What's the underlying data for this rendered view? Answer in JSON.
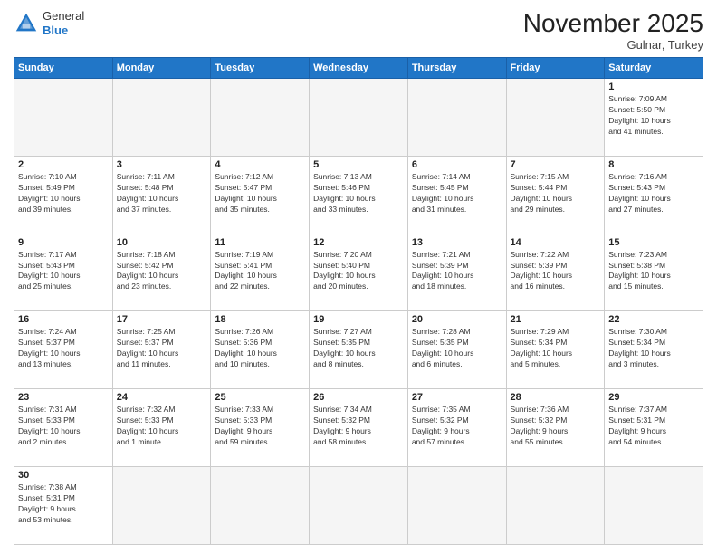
{
  "header": {
    "logo_general": "General",
    "logo_blue": "Blue",
    "month_year": "November 2025",
    "location": "Gulnar, Turkey"
  },
  "weekdays": [
    "Sunday",
    "Monday",
    "Tuesday",
    "Wednesday",
    "Thursday",
    "Friday",
    "Saturday"
  ],
  "days": [
    {
      "num": "",
      "info": ""
    },
    {
      "num": "",
      "info": ""
    },
    {
      "num": "",
      "info": ""
    },
    {
      "num": "",
      "info": ""
    },
    {
      "num": "",
      "info": ""
    },
    {
      "num": "",
      "info": ""
    },
    {
      "num": "1",
      "info": "Sunrise: 7:09 AM\nSunset: 5:50 PM\nDaylight: 10 hours\nand 41 minutes."
    },
    {
      "num": "2",
      "info": "Sunrise: 7:10 AM\nSunset: 5:49 PM\nDaylight: 10 hours\nand 39 minutes."
    },
    {
      "num": "3",
      "info": "Sunrise: 7:11 AM\nSunset: 5:48 PM\nDaylight: 10 hours\nand 37 minutes."
    },
    {
      "num": "4",
      "info": "Sunrise: 7:12 AM\nSunset: 5:47 PM\nDaylight: 10 hours\nand 35 minutes."
    },
    {
      "num": "5",
      "info": "Sunrise: 7:13 AM\nSunset: 5:46 PM\nDaylight: 10 hours\nand 33 minutes."
    },
    {
      "num": "6",
      "info": "Sunrise: 7:14 AM\nSunset: 5:45 PM\nDaylight: 10 hours\nand 31 minutes."
    },
    {
      "num": "7",
      "info": "Sunrise: 7:15 AM\nSunset: 5:44 PM\nDaylight: 10 hours\nand 29 minutes."
    },
    {
      "num": "8",
      "info": "Sunrise: 7:16 AM\nSunset: 5:43 PM\nDaylight: 10 hours\nand 27 minutes."
    },
    {
      "num": "9",
      "info": "Sunrise: 7:17 AM\nSunset: 5:43 PM\nDaylight: 10 hours\nand 25 minutes."
    },
    {
      "num": "10",
      "info": "Sunrise: 7:18 AM\nSunset: 5:42 PM\nDaylight: 10 hours\nand 23 minutes."
    },
    {
      "num": "11",
      "info": "Sunrise: 7:19 AM\nSunset: 5:41 PM\nDaylight: 10 hours\nand 22 minutes."
    },
    {
      "num": "12",
      "info": "Sunrise: 7:20 AM\nSunset: 5:40 PM\nDaylight: 10 hours\nand 20 minutes."
    },
    {
      "num": "13",
      "info": "Sunrise: 7:21 AM\nSunset: 5:39 PM\nDaylight: 10 hours\nand 18 minutes."
    },
    {
      "num": "14",
      "info": "Sunrise: 7:22 AM\nSunset: 5:39 PM\nDaylight: 10 hours\nand 16 minutes."
    },
    {
      "num": "15",
      "info": "Sunrise: 7:23 AM\nSunset: 5:38 PM\nDaylight: 10 hours\nand 15 minutes."
    },
    {
      "num": "16",
      "info": "Sunrise: 7:24 AM\nSunset: 5:37 PM\nDaylight: 10 hours\nand 13 minutes."
    },
    {
      "num": "17",
      "info": "Sunrise: 7:25 AM\nSunset: 5:37 PM\nDaylight: 10 hours\nand 11 minutes."
    },
    {
      "num": "18",
      "info": "Sunrise: 7:26 AM\nSunset: 5:36 PM\nDaylight: 10 hours\nand 10 minutes."
    },
    {
      "num": "19",
      "info": "Sunrise: 7:27 AM\nSunset: 5:35 PM\nDaylight: 10 hours\nand 8 minutes."
    },
    {
      "num": "20",
      "info": "Sunrise: 7:28 AM\nSunset: 5:35 PM\nDaylight: 10 hours\nand 6 minutes."
    },
    {
      "num": "21",
      "info": "Sunrise: 7:29 AM\nSunset: 5:34 PM\nDaylight: 10 hours\nand 5 minutes."
    },
    {
      "num": "22",
      "info": "Sunrise: 7:30 AM\nSunset: 5:34 PM\nDaylight: 10 hours\nand 3 minutes."
    },
    {
      "num": "23",
      "info": "Sunrise: 7:31 AM\nSunset: 5:33 PM\nDaylight: 10 hours\nand 2 minutes."
    },
    {
      "num": "24",
      "info": "Sunrise: 7:32 AM\nSunset: 5:33 PM\nDaylight: 10 hours\nand 1 minute."
    },
    {
      "num": "25",
      "info": "Sunrise: 7:33 AM\nSunset: 5:33 PM\nDaylight: 9 hours\nand 59 minutes."
    },
    {
      "num": "26",
      "info": "Sunrise: 7:34 AM\nSunset: 5:32 PM\nDaylight: 9 hours\nand 58 minutes."
    },
    {
      "num": "27",
      "info": "Sunrise: 7:35 AM\nSunset: 5:32 PM\nDaylight: 9 hours\nand 57 minutes."
    },
    {
      "num": "28",
      "info": "Sunrise: 7:36 AM\nSunset: 5:32 PM\nDaylight: 9 hours\nand 55 minutes."
    },
    {
      "num": "29",
      "info": "Sunrise: 7:37 AM\nSunset: 5:31 PM\nDaylight: 9 hours\nand 54 minutes."
    },
    {
      "num": "30",
      "info": "Sunrise: 7:38 AM\nSunset: 5:31 PM\nDaylight: 9 hours\nand 53 minutes."
    },
    {
      "num": "",
      "info": ""
    },
    {
      "num": "",
      "info": ""
    },
    {
      "num": "",
      "info": ""
    },
    {
      "num": "",
      "info": ""
    },
    {
      "num": "",
      "info": ""
    },
    {
      "num": "",
      "info": ""
    }
  ]
}
